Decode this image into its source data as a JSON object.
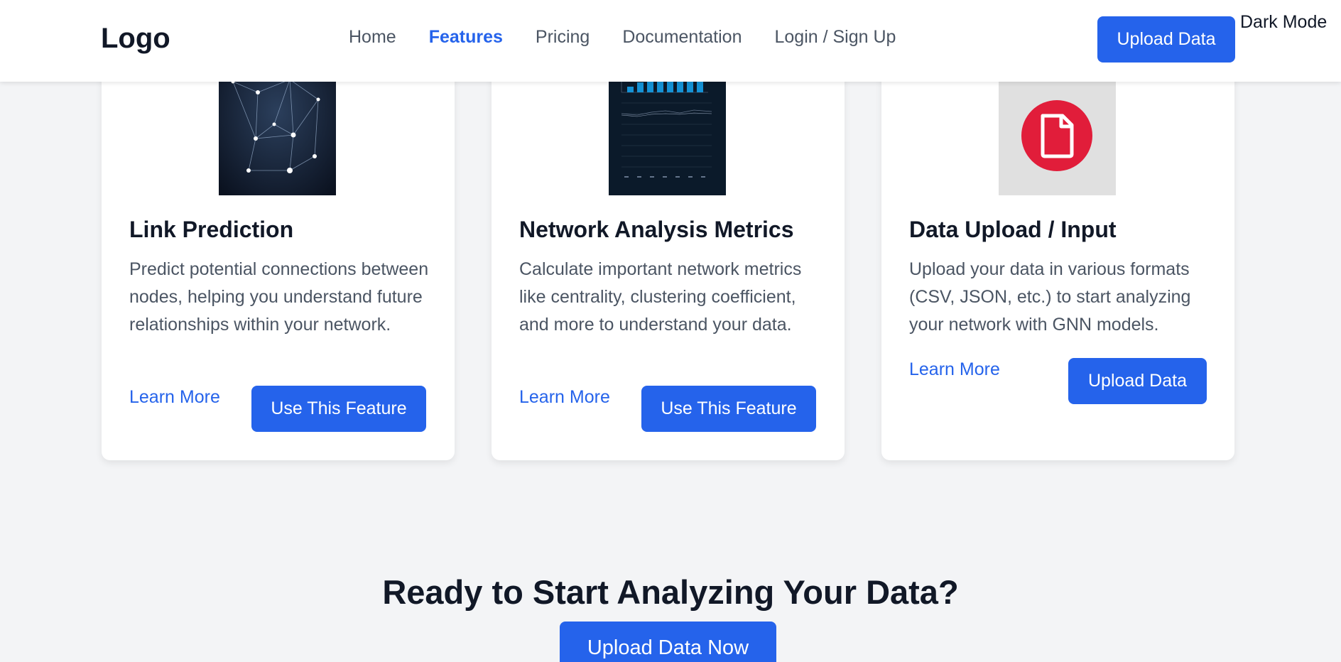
{
  "header": {
    "logo": "Logo",
    "nav": [
      "Home",
      "Features",
      "Pricing",
      "Documentation",
      "Login / Sign Up"
    ],
    "active_nav": "Features",
    "upload_button": "Upload Data",
    "dark_mode_toggle": "Dark Mode"
  },
  "cards": [
    {
      "image": "network-graph-image",
      "title": "Link Prediction",
      "description": "Predict potential connections between nodes, helping you understand future relationships within your network.",
      "learn_more": "Learn More",
      "button": "Use This Feature"
    },
    {
      "image": "metrics-chart-image",
      "title": "Network Analysis Metrics",
      "description": "Calculate important network metrics like centrality, clustering coefficient, and more to understand your data.",
      "learn_more": "Learn More",
      "button": "Use This Feature"
    },
    {
      "image": "file-icon",
      "title": "Data Upload / Input",
      "description": "Upload your data in various formats (CSV, JSON, etc.) to start analyzing your network with GNN models.",
      "learn_more": "Learn More",
      "button": "Upload Data"
    }
  ],
  "cta": {
    "title": "Ready to Start Analyzing Your Data?",
    "button": "Upload Data Now"
  },
  "colors": {
    "accent": "#2563eb",
    "background": "#f3f4f6",
    "card": "#ffffff",
    "file_icon_red": "#e11d3a"
  }
}
